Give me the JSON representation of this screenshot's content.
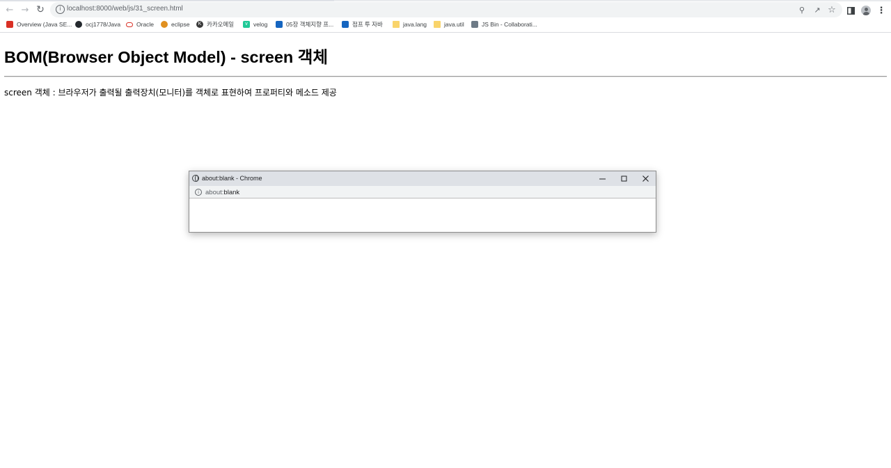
{
  "browser": {
    "url": "localhost:8000/web/js/31_screen.html",
    "back_icon": "back-arrow-icon",
    "forward_icon": "forward-arrow-icon",
    "reload_icon": "reload-icon"
  },
  "bookmarks": [
    {
      "label": "Overview (Java SE...",
      "icon": "oracle-java-icon",
      "color": "#d93025"
    },
    {
      "label": "ocj1778/Java",
      "icon": "github-icon",
      "color": "#24292e"
    },
    {
      "label": "Oracle",
      "icon": "oracle-icon",
      "color": "#d93025"
    },
    {
      "label": "eclipse",
      "icon": "eclipse-icon",
      "color": "#e09020"
    },
    {
      "label": "카카오메일",
      "icon": "kakao-icon",
      "color": "#3a3a3a"
    },
    {
      "label": "velog",
      "icon": "velog-icon",
      "color": "#20c997"
    },
    {
      "label": "05장 객체지향 프...",
      "icon": "doc-icon",
      "color": "#1565c0"
    },
    {
      "label": "점프 투 자바",
      "icon": "wikidocs-icon",
      "color": "#1565c0"
    },
    {
      "label": "java.lang",
      "icon": "folder-icon",
      "color": "#f9d46b"
    },
    {
      "label": "java.util",
      "icon": "folder-icon",
      "color": "#f9d46b"
    },
    {
      "label": "JS Bin - Collaborati...",
      "icon": "jsbin-icon",
      "color": "#6d7a86"
    }
  ],
  "page": {
    "title": "BOM(Browser Object Model) - screen 객체",
    "description": "screen 객체 : 브라우저가 출력될 출력장치(모니터)를 객체로 표현하여 프로퍼티와 메소드 제공"
  },
  "popup": {
    "title": "about:blank - Chrome",
    "url_prefix": "about:",
    "url_host": "blank"
  }
}
